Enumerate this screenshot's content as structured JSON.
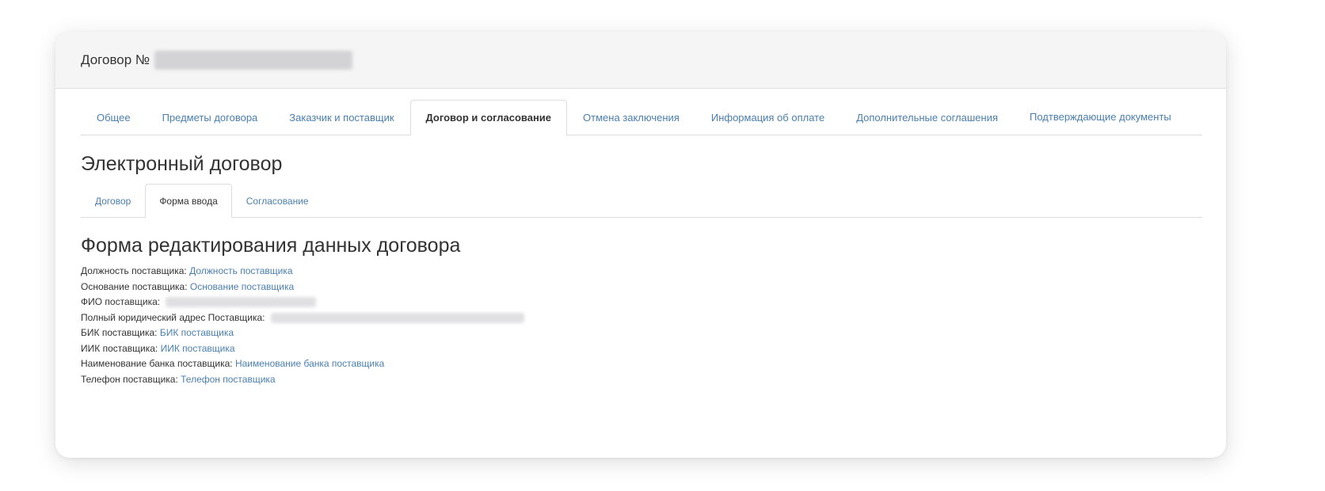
{
  "header": {
    "title": "Договор №"
  },
  "main_tabs": [
    {
      "label": "Общее",
      "active": false
    },
    {
      "label": "Предметы договора",
      "active": false
    },
    {
      "label": "Заказчик и поставщик",
      "active": false
    },
    {
      "label": "Договор и согласование",
      "active": true
    },
    {
      "label": "Отмена заключения",
      "active": false
    },
    {
      "label": "Информация об оплате",
      "active": false
    },
    {
      "label": "Дополнительные соглашения",
      "active": false
    },
    {
      "label": "Подтверждающие документы",
      "active": false
    }
  ],
  "section_title": "Электронный договор",
  "sub_tabs": [
    {
      "label": "Договор",
      "active": false
    },
    {
      "label": "Форма ввода",
      "active": true
    },
    {
      "label": "Согласование",
      "active": false
    }
  ],
  "form_title": "Форма редактирования данных договора",
  "fields": [
    {
      "label": "Должность поставщика:",
      "value": "Должность поставщика"
    },
    {
      "label": "Основание поставщика:",
      "value": "Основание поставщика"
    },
    {
      "label": "ФИО поставщика:",
      "value": ""
    },
    {
      "label": "Полный юридический адрес Поставщика:",
      "value": ""
    },
    {
      "label": "БИК поставщика:",
      "value": "БИК поставщика"
    },
    {
      "label": "ИИК поставщика:",
      "value": "ИИК поставщика"
    },
    {
      "label": "Наименование банка поставщика:",
      "value": "Наименование банка поставщика"
    },
    {
      "label": "Телефон поставщика:",
      "value": "Телефон поставщика"
    }
  ],
  "colors": {
    "link": "#4a7fb0",
    "text": "#333333",
    "header_bg": "#f5f5f5",
    "border": "#dddddd"
  }
}
